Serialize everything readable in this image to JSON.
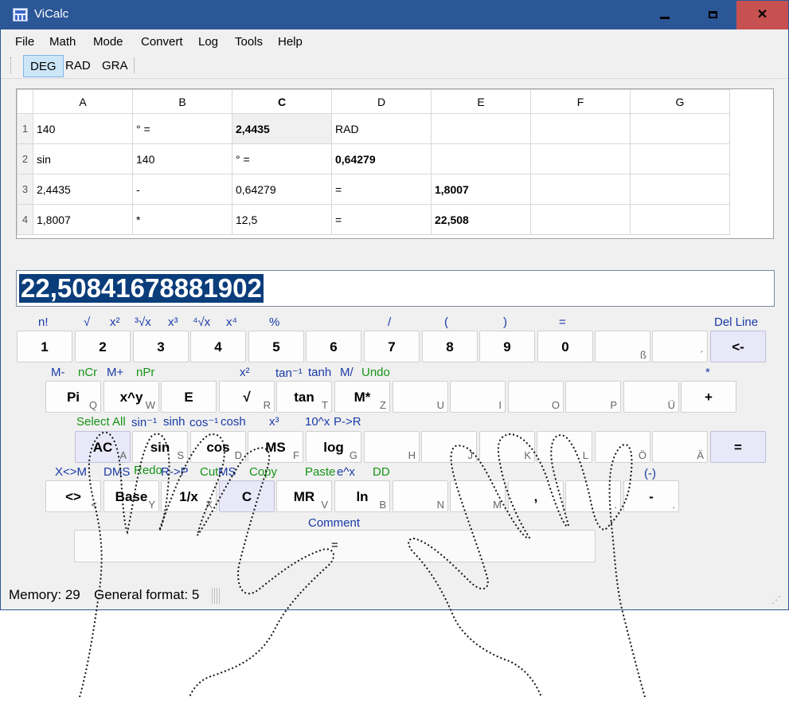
{
  "window": {
    "title": "ViCalc"
  },
  "menu": [
    "File",
    "Math",
    "Mode",
    "Convert",
    "Log",
    "Tools",
    "Help"
  ],
  "toolbar": {
    "angle_modes": [
      "DEG",
      "RAD",
      "GRA"
    ],
    "active": "DEG"
  },
  "sheet": {
    "columns": [
      "A",
      "B",
      "C",
      "D",
      "E",
      "F",
      "G"
    ],
    "rows": [
      {
        "num": "1",
        "cells": [
          "140",
          "° =",
          "2,4435",
          "RAD",
          "",
          "",
          ""
        ]
      },
      {
        "num": "2",
        "cells": [
          "sin",
          "140",
          "° =",
          "0,64279",
          "",
          "",
          ""
        ]
      },
      {
        "num": "3",
        "cells": [
          "2,4435",
          "-",
          "0,64279",
          "=",
          "1,8007",
          "",
          ""
        ]
      },
      {
        "num": "4",
        "cells": [
          "1,8007",
          "*",
          "12,5",
          "=",
          "22,508",
          "",
          ""
        ]
      }
    ]
  },
  "display": {
    "value": "22,50841678881902"
  },
  "row1": {
    "labels": [
      "n!",
      "√",
      "x²",
      "³√x",
      "x³",
      "⁴√x",
      "x⁴",
      "%",
      "/",
      "(",
      ")",
      "=",
      "Del Line"
    ],
    "keys": [
      "1",
      "2",
      "3",
      "4",
      "5",
      "6",
      "7",
      "8",
      "9",
      "0",
      "",
      "",
      "<-"
    ],
    "subs": [
      "",
      "",
      "",
      "",
      "",
      "",
      "",
      "",
      "",
      "",
      "ß",
      "´",
      ""
    ]
  },
  "row2": {
    "labels_blue": [
      "M-",
      "M+",
      "x²",
      "tan⁻¹",
      "tanh",
      "M/",
      "*"
    ],
    "labels_green": [
      "nCr",
      "nPr",
      "Undo"
    ],
    "keys": [
      "Pi",
      "x^y",
      "E",
      "√",
      "tan",
      "M*",
      "",
      "",
      "",
      "",
      "",
      "+"
    ],
    "subs": [
      "Q",
      "W",
      "",
      "R",
      "T",
      "Z",
      "U",
      "I",
      "O",
      "P",
      "Ü",
      ""
    ]
  },
  "row3": {
    "labels_green": [
      "Select All"
    ],
    "labels_blue": [
      "sin⁻¹",
      "sinh",
      "cos⁻¹",
      "cosh",
      "x³",
      "10^x",
      "P->R"
    ],
    "keys": [
      "AC",
      "sin",
      "cos",
      "MS",
      "log",
      "",
      "",
      "",
      "",
      "",
      "",
      "="
    ],
    "subs": [
      "A",
      "S",
      "D",
      "F",
      "G",
      "H",
      "J",
      "K",
      "L",
      "Ö",
      "Ä",
      ""
    ]
  },
  "row4": {
    "labels_blue": [
      "X<>M",
      "DMS",
      "R->P",
      "MS",
      "e^x",
      "(-)"
    ],
    "labels_green": [
      "Redo",
      "Cut",
      "Copy",
      "Paste",
      "DD"
    ],
    "keys": [
      "<>",
      "Base",
      "1/x",
      "C",
      "MR",
      "ln",
      "",
      "",
      ",",
      "",
      "-"
    ],
    "subs": [
      "<",
      "Y",
      "X",
      "",
      "V",
      "B",
      "N",
      "M",
      "",
      ".",
      "."
    ]
  },
  "comment": {
    "label": "Comment",
    "value": "="
  },
  "status": {
    "memory": "Memory: 29",
    "format": "General format: 5"
  },
  "colors": {
    "title_bar": "#2b5797",
    "close": "#c75050",
    "label_blue": "#1a3aa8",
    "label_green": "#169416",
    "display_highlight": "#0a3d7a"
  }
}
